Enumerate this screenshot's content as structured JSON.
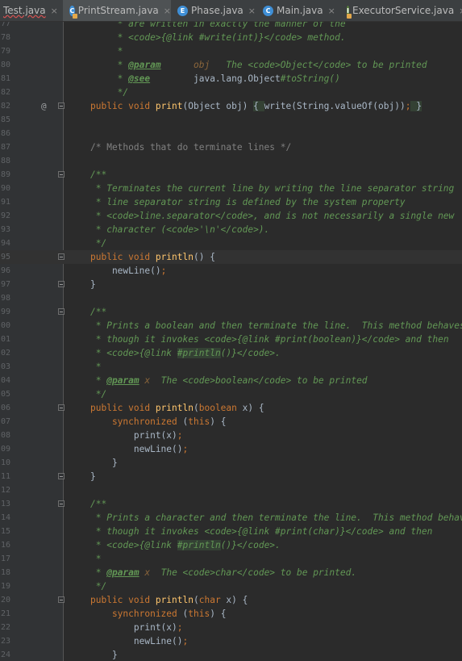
{
  "tabs": [
    {
      "label": "Test.java",
      "icon": "java-class-icon",
      "active": false,
      "error": true
    },
    {
      "label": "PrintStream.java",
      "icon": "java-class-locked-icon",
      "active": true
    },
    {
      "label": "Phase.java",
      "icon": "enum-icon",
      "active": false
    },
    {
      "label": "Main.java",
      "icon": "java-class-icon",
      "active": false
    },
    {
      "label": "ExecutorService.java",
      "icon": "interface-locked-icon",
      "active": false
    }
  ],
  "colors": {
    "keyword": "#cc7832",
    "method": "#ffc66d",
    "comment": "#808080",
    "javadoc": "#629755",
    "background": "#2b2b2b"
  },
  "lines": [
    {
      "n": "77",
      "fold": false,
      "tokens": [
        {
          "t": "     * are written in exactly the manner of the",
          "c": "doc"
        }
      ]
    },
    {
      "n": "78",
      "fold": false,
      "tokens": [
        {
          "t": "     * <code>",
          "c": "doc"
        },
        {
          "t": "{@link",
          "c": "doc"
        },
        {
          "t": " #write(int)}</code> method.",
          "c": "doc"
        }
      ]
    },
    {
      "n": "79",
      "fold": false,
      "tokens": [
        {
          "t": "     *",
          "c": "doc"
        }
      ]
    },
    {
      "n": "80",
      "fold": false,
      "tokens": [
        {
          "t": "     * ",
          "c": "doc"
        },
        {
          "t": "@param",
          "c": "doctag"
        },
        {
          "t": "      obj",
          "c": "docparam"
        },
        {
          "t": "   The <code>Object</code> to be printed",
          "c": "doc"
        }
      ]
    },
    {
      "n": "81",
      "fold": false,
      "tokens": [
        {
          "t": "     * ",
          "c": "doc"
        },
        {
          "t": "@see",
          "c": "doctag"
        },
        {
          "t": "        java.lang.Object",
          "c": "plain"
        },
        {
          "t": "#toString()",
          "c": "doc"
        }
      ]
    },
    {
      "n": "82",
      "fold": false,
      "tokens": [
        {
          "t": "     */",
          "c": "doc"
        }
      ]
    },
    {
      "n": "82",
      "fold": true,
      "at": true,
      "tokens": [
        {
          "t": "public void ",
          "c": "kw"
        },
        {
          "t": "print",
          "c": "fn"
        },
        {
          "t": "(Object obj) ",
          "c": "plain"
        },
        {
          "t": "{ ",
          "c": "hl"
        },
        {
          "t": "write(String.",
          "c": "plain"
        },
        {
          "t": "valueOf",
          "c": "plain"
        },
        {
          "t": "(obj))",
          "c": "plain"
        },
        {
          "t": ";",
          "c": "kw"
        },
        {
          "t": " }",
          "c": "hl"
        }
      ]
    },
    {
      "n": "85",
      "fold": false,
      "tokens": []
    },
    {
      "n": "86",
      "fold": false,
      "tokens": []
    },
    {
      "n": "87",
      "fold": false,
      "tokens": [
        {
          "t": "/* Methods that do terminate lines */",
          "c": "cm"
        }
      ]
    },
    {
      "n": "88",
      "fold": false,
      "tokens": []
    },
    {
      "n": "89",
      "fold": true,
      "tokens": [
        {
          "t": "/**",
          "c": "doc"
        }
      ]
    },
    {
      "n": "90",
      "fold": false,
      "tokens": [
        {
          "t": " * Terminates the current line by writing the line separator string",
          "c": "doc"
        }
      ]
    },
    {
      "n": "91",
      "fold": false,
      "tokens": [
        {
          "t": " * line separator string is defined by the system property",
          "c": "doc"
        }
      ]
    },
    {
      "n": "92",
      "fold": false,
      "tokens": [
        {
          "t": " * <code>line.separator</code>, and is not necessarily a single new",
          "c": "doc"
        }
      ]
    },
    {
      "n": "93",
      "fold": false,
      "tokens": [
        {
          "t": " * character (<code>'\\n'</code>).",
          "c": "doc"
        }
      ]
    },
    {
      "n": "94",
      "fold": false,
      "tokens": [
        {
          "t": " */",
          "c": "doc"
        }
      ]
    },
    {
      "n": "95",
      "fold": true,
      "current": true,
      "tokens": [
        {
          "t": "public void ",
          "c": "kw"
        },
        {
          "t": "println",
          "c": "fn"
        },
        {
          "t": "() {",
          "c": "plain"
        }
      ]
    },
    {
      "n": "96",
      "fold": false,
      "tokens": [
        {
          "t": "    newLine()",
          "c": "plain"
        },
        {
          "t": ";",
          "c": "kw"
        }
      ]
    },
    {
      "n": "97",
      "fold": true,
      "tokens": [
        {
          "t": "}",
          "c": "plain"
        }
      ]
    },
    {
      "n": "98",
      "fold": false,
      "tokens": []
    },
    {
      "n": "99",
      "fold": true,
      "tokens": [
        {
          "t": "/**",
          "c": "doc"
        }
      ]
    },
    {
      "n": "00",
      "fold": false,
      "tokens": [
        {
          "t": " * Prints a boolean and then terminate the line.  This method behaves",
          "c": "doc"
        }
      ]
    },
    {
      "n": "01",
      "fold": false,
      "tokens": [
        {
          "t": " * though it invokes <code>",
          "c": "doc"
        },
        {
          "t": "{@link",
          "c": "doc"
        },
        {
          "t": " #print(boolean)}</code> and then",
          "c": "doc"
        }
      ]
    },
    {
      "n": "02",
      "fold": false,
      "tokens": [
        {
          "t": " * <code>",
          "c": "doc"
        },
        {
          "t": "{@link",
          "c": "doc"
        },
        {
          "t": " ",
          "c": "doc"
        },
        {
          "t": "#println",
          "c": "doclink"
        },
        {
          "t": "()}</code>.",
          "c": "doc"
        }
      ]
    },
    {
      "n": "03",
      "fold": false,
      "tokens": [
        {
          "t": " *",
          "c": "doc"
        }
      ]
    },
    {
      "n": "04",
      "fold": false,
      "tokens": [
        {
          "t": " * ",
          "c": "doc"
        },
        {
          "t": "@param",
          "c": "doctag"
        },
        {
          "t": " x",
          "c": "docparam"
        },
        {
          "t": "  The <code>boolean</code> to be printed",
          "c": "doc"
        }
      ]
    },
    {
      "n": "05",
      "fold": false,
      "tokens": [
        {
          "t": " */",
          "c": "doc"
        }
      ]
    },
    {
      "n": "06",
      "fold": true,
      "tokens": [
        {
          "t": "public void ",
          "c": "kw"
        },
        {
          "t": "println",
          "c": "fn"
        },
        {
          "t": "(",
          "c": "plain"
        },
        {
          "t": "boolean ",
          "c": "kw"
        },
        {
          "t": "x) {",
          "c": "plain"
        }
      ]
    },
    {
      "n": "07",
      "fold": false,
      "tokens": [
        {
          "t": "    synchronized ",
          "c": "kw"
        },
        {
          "t": "(",
          "c": "plain"
        },
        {
          "t": "this",
          "c": "kw"
        },
        {
          "t": ") {",
          "c": "plain"
        }
      ]
    },
    {
      "n": "08",
      "fold": false,
      "tokens": [
        {
          "t": "        print(x)",
          "c": "plain"
        },
        {
          "t": ";",
          "c": "kw"
        }
      ]
    },
    {
      "n": "09",
      "fold": false,
      "tokens": [
        {
          "t": "        newLine()",
          "c": "plain"
        },
        {
          "t": ";",
          "c": "kw"
        }
      ]
    },
    {
      "n": "10",
      "fold": false,
      "tokens": [
        {
          "t": "    }",
          "c": "plain"
        }
      ]
    },
    {
      "n": "11",
      "fold": true,
      "tokens": [
        {
          "t": "}",
          "c": "plain"
        }
      ]
    },
    {
      "n": "12",
      "fold": false,
      "tokens": []
    },
    {
      "n": "13",
      "fold": true,
      "tokens": [
        {
          "t": "/**",
          "c": "doc"
        }
      ]
    },
    {
      "n": "14",
      "fold": false,
      "tokens": [
        {
          "t": " * Prints a character and then terminate the line.  This method behaves",
          "c": "doc"
        }
      ]
    },
    {
      "n": "15",
      "fold": false,
      "tokens": [
        {
          "t": " * though it invokes <code>",
          "c": "doc"
        },
        {
          "t": "{@link",
          "c": "doc"
        },
        {
          "t": " #print(char)}</code> and then",
          "c": "doc"
        }
      ]
    },
    {
      "n": "16",
      "fold": false,
      "tokens": [
        {
          "t": " * <code>",
          "c": "doc"
        },
        {
          "t": "{@link",
          "c": "doc"
        },
        {
          "t": " ",
          "c": "doc"
        },
        {
          "t": "#println",
          "c": "doclink"
        },
        {
          "t": "()}</code>.",
          "c": "doc"
        }
      ]
    },
    {
      "n": "17",
      "fold": false,
      "tokens": [
        {
          "t": " *",
          "c": "doc"
        }
      ]
    },
    {
      "n": "18",
      "fold": false,
      "tokens": [
        {
          "t": " * ",
          "c": "doc"
        },
        {
          "t": "@param",
          "c": "doctag"
        },
        {
          "t": " x",
          "c": "docparam"
        },
        {
          "t": "  The <code>char</code> to be printed.",
          "c": "doc"
        }
      ]
    },
    {
      "n": "19",
      "fold": false,
      "tokens": [
        {
          "t": " */",
          "c": "doc"
        }
      ]
    },
    {
      "n": "20",
      "fold": true,
      "tokens": [
        {
          "t": "public void ",
          "c": "kw"
        },
        {
          "t": "println",
          "c": "fn"
        },
        {
          "t": "(",
          "c": "plain"
        },
        {
          "t": "char ",
          "c": "kw"
        },
        {
          "t": "x) {",
          "c": "plain"
        }
      ]
    },
    {
      "n": "21",
      "fold": false,
      "tokens": [
        {
          "t": "    synchronized ",
          "c": "kw"
        },
        {
          "t": "(",
          "c": "plain"
        },
        {
          "t": "this",
          "c": "kw"
        },
        {
          "t": ") {",
          "c": "plain"
        }
      ]
    },
    {
      "n": "22",
      "fold": false,
      "tokens": [
        {
          "t": "        print(x)",
          "c": "plain"
        },
        {
          "t": ";",
          "c": "kw"
        }
      ]
    },
    {
      "n": "23",
      "fold": false,
      "tokens": [
        {
          "t": "        newLine()",
          "c": "plain"
        },
        {
          "t": ";",
          "c": "kw"
        }
      ]
    },
    {
      "n": "24",
      "fold": false,
      "tokens": [
        {
          "t": "    }",
          "c": "plain"
        }
      ]
    }
  ]
}
